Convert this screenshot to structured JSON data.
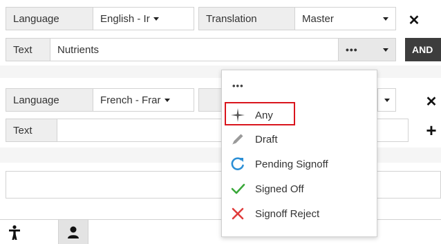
{
  "row1": {
    "language_label": "Language",
    "language_value": "English - Ir",
    "translation_label": "Translation",
    "translation_value": "Master"
  },
  "row2": {
    "text_label": "Text",
    "text_value": "Nutrients",
    "more_label": "•••",
    "and_label": "AND"
  },
  "row3": {
    "language_label": "Language",
    "language_value": "French - Frar"
  },
  "row4": {
    "text_label": "Text",
    "text_value": ""
  },
  "menu": {
    "header": "•••",
    "items": [
      {
        "label": "Any",
        "icon": "plus-icon",
        "color": "#555555"
      },
      {
        "label": "Draft",
        "icon": "pencil-icon",
        "color": "#9a9a9a"
      },
      {
        "label": "Pending Signoff",
        "icon": "refresh-icon",
        "color": "#2b8fd6"
      },
      {
        "label": "Signed Off",
        "icon": "check-icon",
        "color": "#3aa83a"
      },
      {
        "label": "Signoff Reject",
        "icon": "x-icon",
        "color": "#e03c3c"
      }
    ]
  },
  "icons": {
    "close": "✕",
    "add": "+"
  },
  "highlight_color": "#d9141c"
}
